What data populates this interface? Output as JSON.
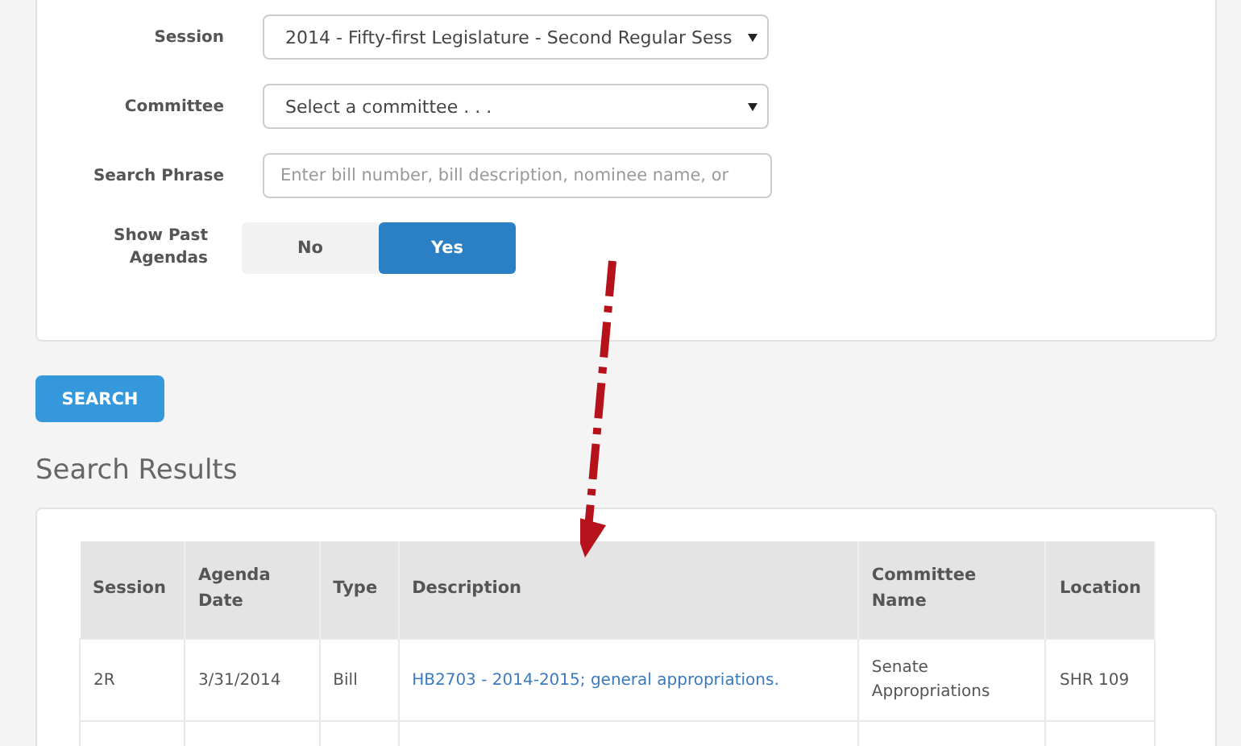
{
  "form": {
    "fields": [
      {
        "kind": "select",
        "label": "Session",
        "value": "2014 - Fifty-first Legislature - Second Regular Sess"
      },
      {
        "kind": "select",
        "label": "Committee",
        "value": "Select a committee . . ."
      },
      {
        "kind": "text",
        "label": "Search Phrase",
        "placeholder": "Enter bill number, bill description, nominee name, or"
      }
    ],
    "toggle": {
      "label": "Show Past Agendas",
      "options": [
        {
          "label": "No",
          "selected": false
        },
        {
          "label": "Yes",
          "selected": true
        }
      ]
    }
  },
  "search_button": "SEARCH",
  "results": {
    "heading": "Search Results",
    "table": {
      "columns": [
        "Session",
        "Agenda Date",
        "Type",
        "Description",
        "Committee Name",
        "Location"
      ],
      "rows": [
        {
          "session": "2R",
          "agenda_date": "3/31/2014",
          "type": "Bill",
          "description": "HB2703 - 2014-2015; general appropriations.",
          "committee_name": "Senate Appropriations",
          "location": "SHR 109"
        }
      ]
    }
  }
}
